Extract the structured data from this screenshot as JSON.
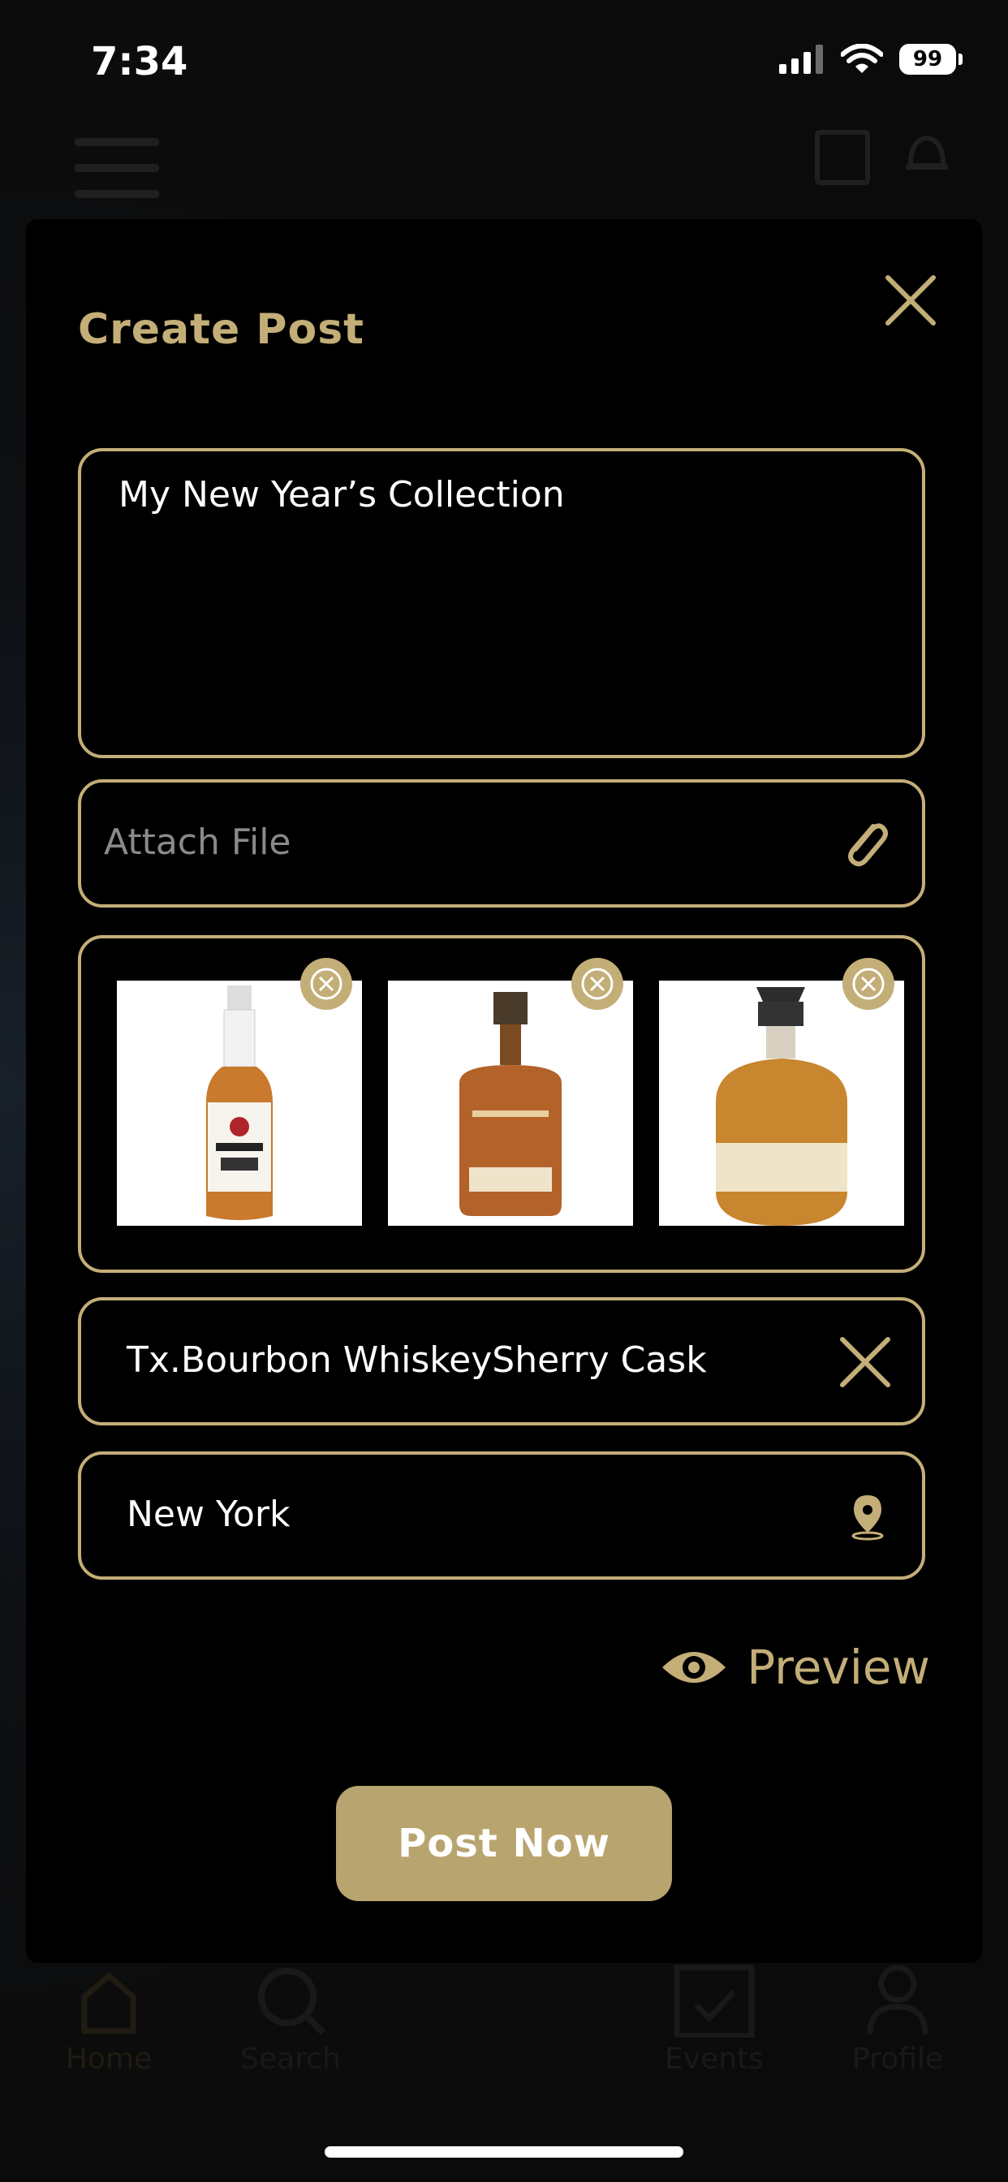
{
  "status_bar": {
    "time": "7:34",
    "battery": "99",
    "icons": [
      "cellular-signal-icon",
      "wifi-icon",
      "battery-icon"
    ]
  },
  "background_tabs": [
    {
      "label": "Home",
      "icon": "home-icon"
    },
    {
      "label": "Search",
      "icon": "search-icon"
    },
    {
      "label": "Events",
      "icon": "calendar-check-icon"
    },
    {
      "label": "Profile",
      "icon": "profile-icon"
    }
  ],
  "modal": {
    "title": "Create Post",
    "close_icon": "close-icon",
    "description": {
      "value": "My New Year’s Collection"
    },
    "attach": {
      "placeholder": "Attach File",
      "icon": "paperclip-icon"
    },
    "images": [
      {
        "alt": "JIM BEAM BOURBON",
        "remove_icon": "remove-circle-icon"
      },
      {
        "alt": "WOODFORD RESERVE",
        "remove_icon": "remove-circle-icon"
      },
      {
        "alt": "Blanton's",
        "remove_icon": "remove-circle-icon"
      }
    ],
    "tags": {
      "value": "Tx.Bourbon WhiskeySherry Cask",
      "icon": "clear-icon"
    },
    "location": {
      "value": "New York",
      "icon": "location-pin-icon"
    },
    "preview": {
      "label": "Preview",
      "icon": "eye-icon"
    },
    "post_button": {
      "label": "Post Now"
    }
  },
  "colors": {
    "accent": "#c4ae78",
    "button": "#b8a46e",
    "modal_bg": "#000000"
  }
}
